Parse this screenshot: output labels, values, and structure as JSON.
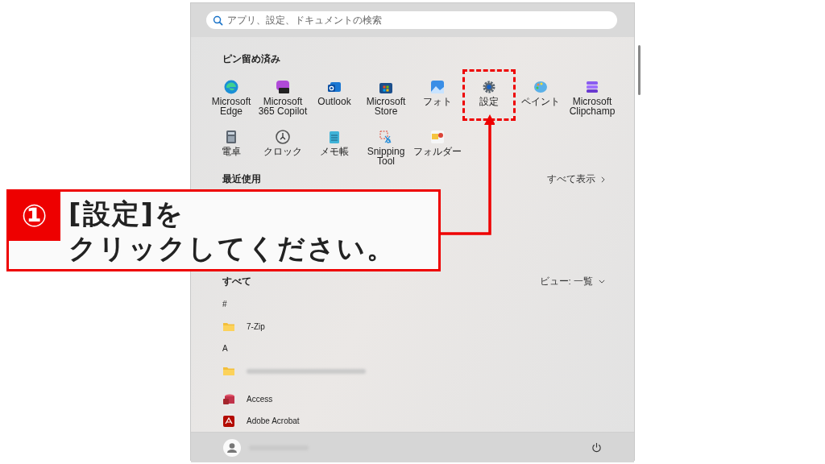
{
  "search": {
    "placeholder": "アプリ、設定、ドキュメントの検索"
  },
  "pinned": {
    "title": "ピン留め済み",
    "apps": [
      {
        "label": "Microsoft Edge",
        "kind": "edge",
        "highlighted": false
      },
      {
        "label": "Microsoft 365 Copilot",
        "kind": "m365",
        "highlighted": false
      },
      {
        "label": "Outlook",
        "kind": "outlook",
        "highlighted": false
      },
      {
        "label": "Microsoft Store",
        "kind": "store",
        "highlighted": false
      },
      {
        "label": "フォト",
        "kind": "photos",
        "highlighted": false
      },
      {
        "label": "設定",
        "kind": "settings",
        "highlighted": true
      },
      {
        "label": "ペイント",
        "kind": "paint",
        "highlighted": false
      },
      {
        "label": "Microsoft Clipchamp",
        "kind": "clipchamp",
        "highlighted": false
      },
      {
        "label": "電卓",
        "kind": "calculator",
        "highlighted": false
      },
      {
        "label": "クロック",
        "kind": "clock",
        "highlighted": false
      },
      {
        "label": "メモ帳",
        "kind": "notepad",
        "highlighted": false
      },
      {
        "label": "Snipping Tool",
        "kind": "snipping",
        "highlighted": false
      },
      {
        "label": "フォルダー",
        "kind": "folders",
        "highlighted": false
      }
    ]
  },
  "recent": {
    "title": "最近使用",
    "show_all": "すべて表示"
  },
  "all_apps": {
    "title": "すべて",
    "view": "ビュー: 一覧",
    "items": [
      {
        "kind": "header",
        "label": "#"
      },
      {
        "kind": "folder",
        "label": "7-Zip"
      },
      {
        "kind": "header",
        "label": "A"
      },
      {
        "kind": "blurred"
      },
      {
        "kind": "access",
        "label": "Access"
      },
      {
        "kind": "acrobat",
        "label": "Adobe Acrobat"
      }
    ]
  },
  "callout": {
    "number": "①",
    "lines": [
      "[設定]を",
      "クリックしてください。"
    ]
  }
}
